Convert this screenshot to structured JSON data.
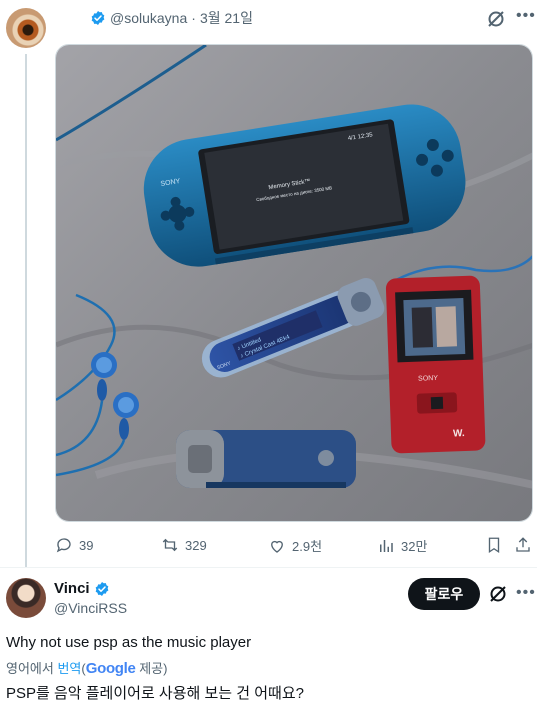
{
  "tweet1": {
    "handle": "@solukayna",
    "separator": "·",
    "date": "3월 21일",
    "stats": {
      "replies": "39",
      "reposts": "329",
      "likes": "2.9천",
      "views": "32만"
    },
    "photo_text": {
      "psp_brand": "SONY",
      "psp_screen_time": "4/1 12:35",
      "psp_memory_stick": "Memory Stick™",
      "psp_memory_line": "Свободное место на диске: 3500 MB",
      "usb_brand": "SONY",
      "usb_screen_line1": "♪ Untitled",
      "usb_screen_line2": "♪ Crystal Cast  4Ek4",
      "walkman_brand": "SONY",
      "walkman_logo": "W."
    }
  },
  "tweet2": {
    "name": "Vinci",
    "handle": "@VinciRSS",
    "follow_label": "팔로우",
    "text": "Why not use psp as the music player",
    "translate_prefix": "영어에서 ",
    "translate_link": "번역",
    "translate_paren_open": "(",
    "google": "Google",
    "translate_suffix": " 제공)",
    "translated_text": "PSP를 음악 플레이어로 사용해 보는 건 어때요?"
  },
  "colors": {
    "verified": "#1d9bf0",
    "muted": "#536471",
    "follow_bg": "#0f1419",
    "photo_bg": "#8e8f94",
    "psp_blue": "#1d6c9c",
    "walkman_red": "#b3202a"
  },
  "icons": [
    "verified-badge-icon",
    "grok-icon",
    "more-icon",
    "reply-icon",
    "repost-icon",
    "like-icon",
    "views-icon",
    "bookmark-icon",
    "share-icon"
  ]
}
